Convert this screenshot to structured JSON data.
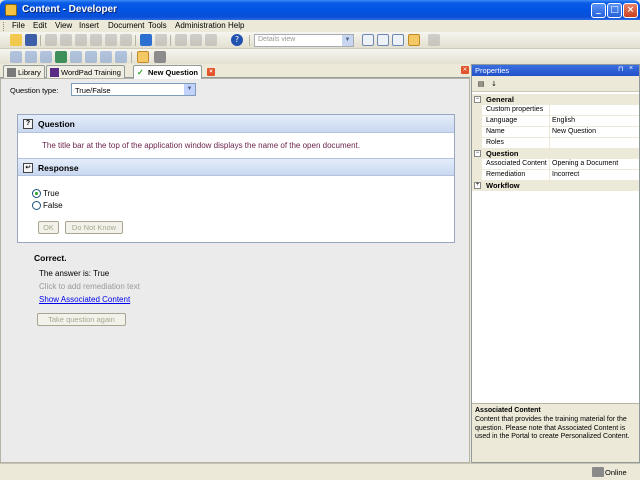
{
  "window": {
    "title": "Content - Developer"
  },
  "menu": [
    "File",
    "Edit",
    "View",
    "Insert",
    "Document",
    "Tools",
    "Administration",
    "Help"
  ],
  "toolbar": {
    "view_select": "Details view"
  },
  "tabs": [
    {
      "label": "Library"
    },
    {
      "label": "WordPad Training"
    },
    {
      "label": "New Question"
    }
  ],
  "question_type": {
    "label": "Question type:",
    "value": "True/False"
  },
  "question": {
    "header": "Question",
    "text": "The title bar at the top of the application window displays the name of the open document."
  },
  "response": {
    "header": "Response",
    "options": [
      {
        "label": "True",
        "checked": true
      },
      {
        "label": "False",
        "checked": false
      }
    ],
    "ok_label": "OK",
    "dont_know_label": "Do Not Know"
  },
  "feedback": {
    "result": "Correct.",
    "answer": "The answer is: True",
    "remediation_prompt": "Click to add remediation text",
    "associated_link": "Show Associated Content",
    "retry_label": "Take question again"
  },
  "properties": {
    "title": "Properties",
    "categories": [
      {
        "name": "General",
        "rows": [
          {
            "name": "Custom properties",
            "value": ""
          },
          {
            "name": "Language",
            "value": "English"
          },
          {
            "name": "Name",
            "value": "New Question"
          },
          {
            "name": "Roles",
            "value": ""
          }
        ]
      },
      {
        "name": "Question",
        "rows": [
          {
            "name": "Associated Content",
            "value": "Opening a Document"
          },
          {
            "name": "Remediation",
            "value": "Incorrect"
          }
        ]
      },
      {
        "name": "Workflow",
        "rows": []
      }
    ],
    "description": {
      "title": "Associated Content",
      "text": "Content that provides the training material for the question. Please note that Associated Content is used in the Portal to create Personalized Content."
    }
  },
  "status": {
    "online": "Online"
  },
  "colors": {
    "titlebar": "#0054E3",
    "accent_orange": "#F3C865",
    "question_text": "#6A1F4A",
    "link": "#0000EE"
  }
}
